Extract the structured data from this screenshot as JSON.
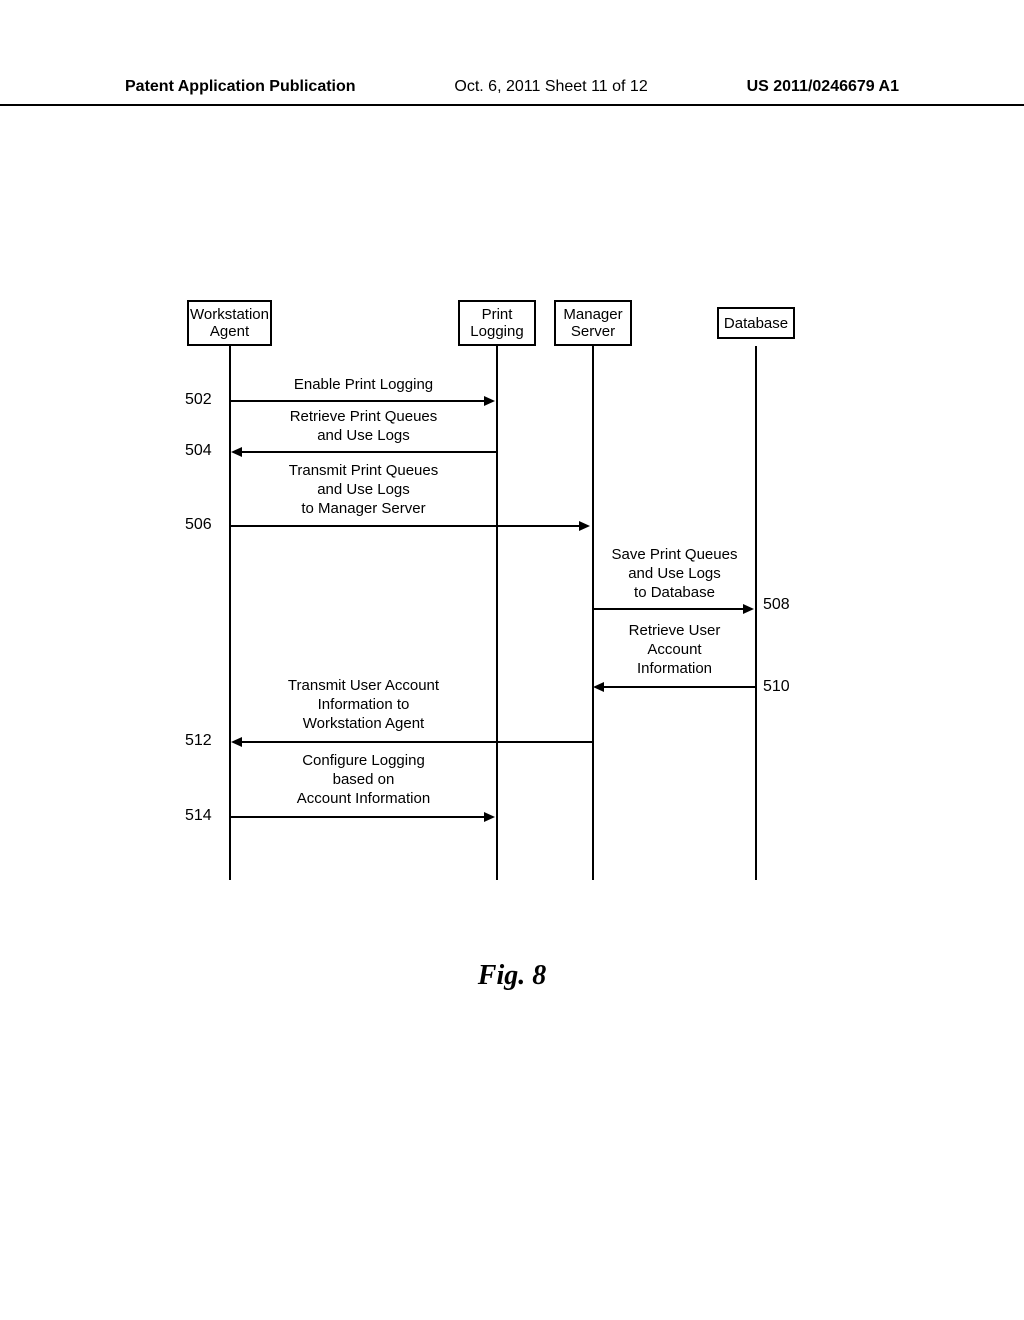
{
  "header": {
    "left": "Patent Application Publication",
    "center": "Oct. 6, 2011   Sheet 11 of 12",
    "right": "US 2011/0246679 A1"
  },
  "lifelines": {
    "workstation": "Workstation\nAgent",
    "printlogging": "Print\nLogging",
    "manager": "Manager\nServer",
    "database": "Database"
  },
  "messages": {
    "m502": "Enable Print Logging",
    "m504": "Retrieve Print Queues\nand Use Logs",
    "m506": "Transmit Print Queues\nand Use Logs\nto Manager Server",
    "m508": "Save Print Queues\nand Use Logs\nto Database",
    "m510": "Retrieve User\nAccount\nInformation",
    "m512": "Transmit User Account\nInformation to\nWorkstation Agent",
    "m514": "Configure Logging\nbased on\nAccount Information"
  },
  "steps": {
    "s502": "502",
    "s504": "504",
    "s506": "506",
    "s508": "508",
    "s510": "510",
    "s512": "512",
    "s514": "514"
  },
  "caption": "Fig. 8",
  "chart_data": {
    "type": "sequence_diagram",
    "participants": [
      "Workstation Agent",
      "Print Logging",
      "Manager Server",
      "Database"
    ],
    "interactions": [
      {
        "id": "502",
        "from": "Workstation Agent",
        "to": "Print Logging",
        "label": "Enable Print Logging"
      },
      {
        "id": "504",
        "from": "Print Logging",
        "to": "Workstation Agent",
        "label": "Retrieve Print Queues and Use Logs"
      },
      {
        "id": "506",
        "from": "Workstation Agent",
        "to": "Manager Server",
        "label": "Transmit Print Queues and Use Logs to Manager Server"
      },
      {
        "id": "508",
        "from": "Manager Server",
        "to": "Database",
        "label": "Save Print Queues and Use Logs to Database"
      },
      {
        "id": "510",
        "from": "Database",
        "to": "Manager Server",
        "label": "Retrieve User Account Information"
      },
      {
        "id": "512",
        "from": "Manager Server",
        "to": "Workstation Agent",
        "label": "Transmit User Account Information to Workstation Agent"
      },
      {
        "id": "514",
        "from": "Workstation Agent",
        "to": "Print Logging",
        "label": "Configure Logging based on Account Information"
      }
    ]
  }
}
